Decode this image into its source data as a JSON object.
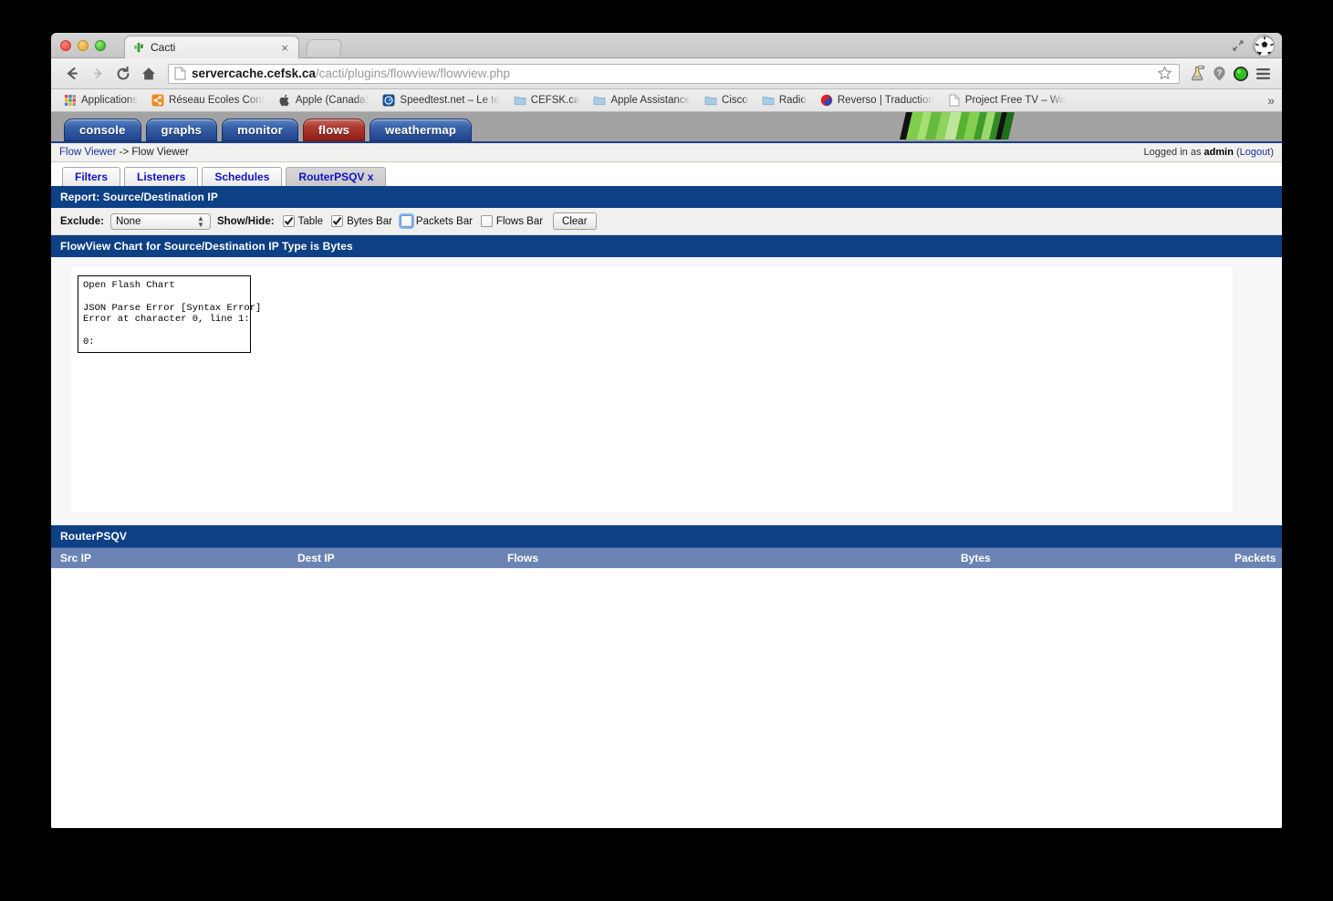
{
  "browser": {
    "tab": {
      "title": "Cacti",
      "favicon": "cactus-icon",
      "close": "×"
    },
    "nav": {
      "back": "←",
      "forward": "→",
      "reload": "↻",
      "home": "home-icon"
    },
    "omnibox": {
      "host": "servercache.cefsk.ca",
      "path": "/cacti/plugins/flowview/flowview.php",
      "page_icon": "page-icon",
      "star": "star-icon"
    },
    "toolbar_icons": [
      "flask-icon",
      "question-pin-icon",
      "green-status-icon",
      "hamburger-menu-icon"
    ],
    "window_icons": [
      "fullscreen-icon",
      "soccer-ball-avatar"
    ],
    "bookmarks": [
      {
        "label": "Applications",
        "icon": "apps-grid-icon"
      },
      {
        "label": "Réseau Écoles Conf",
        "icon": "orange-share-icon"
      },
      {
        "label": "Apple (Canada)",
        "icon": "apple-icon"
      },
      {
        "label": "Speedtest.net – Le te",
        "icon": "speedtest-icon"
      },
      {
        "label": "CEFSK.ca",
        "icon": "folder-icon"
      },
      {
        "label": "Apple Assistance",
        "icon": "folder-icon"
      },
      {
        "label": "Cisco",
        "icon": "folder-icon"
      },
      {
        "label": "Radio",
        "icon": "folder-icon"
      },
      {
        "label": "Reverso | Traduction",
        "icon": "reverso-icon"
      },
      {
        "label": "Project Free TV – Wa",
        "icon": "page-icon"
      }
    ],
    "bookmarks_overflow": "»"
  },
  "cacti": {
    "nav_tabs": [
      {
        "label": "console",
        "color": "blue"
      },
      {
        "label": "graphs",
        "color": "blue"
      },
      {
        "label": "monitor",
        "color": "blue"
      },
      {
        "label": "flows",
        "color": "red"
      },
      {
        "label": "weathermap",
        "color": "blue"
      }
    ],
    "breadcrumb": {
      "link": "Flow Viewer",
      "separator": "->",
      "current": "Flow Viewer"
    },
    "login": {
      "prefix": "Logged in as",
      "user": "admin",
      "logout_open": "(",
      "logout": "Logout",
      "logout_close": ")"
    },
    "inner_tabs": [
      {
        "label": "Filters",
        "active": false
      },
      {
        "label": "Listeners",
        "active": false
      },
      {
        "label": "Schedules",
        "active": false
      },
      {
        "label": "RouterPSQV x",
        "active": true
      }
    ],
    "report_bar": "Report: Source/Destination IP",
    "filters": {
      "exclude_label": "Exclude:",
      "exclude_value": "None",
      "showhide_label": "Show/Hide:",
      "checkboxes": [
        {
          "label": "Table",
          "checked": true,
          "focused": false
        },
        {
          "label": "Bytes Bar",
          "checked": true,
          "focused": false
        },
        {
          "label": "Packets Bar",
          "checked": false,
          "focused": true
        },
        {
          "label": "Flows Bar",
          "checked": false,
          "focused": false
        }
      ],
      "clear_label": "Clear"
    },
    "chart_bar": "FlowView Chart for Source/Destination IP Type is Bytes",
    "ofc_error": "Open Flash Chart\n\nJSON Parse Error [Syntax Error]\nError at character 0, line 1:\n\n0:",
    "table": {
      "title": "RouterPSQV",
      "columns": [
        "Src IP",
        "Dest IP",
        "Flows",
        "Bytes",
        "Packets"
      ],
      "rows": []
    }
  },
  "colors": {
    "cacti_blue": "#0d4084",
    "table_header_blue": "#6b84b4",
    "link_blue": "#17359e",
    "tab_text_blue": "#1212c4",
    "flows_red": "#ad3b33"
  }
}
